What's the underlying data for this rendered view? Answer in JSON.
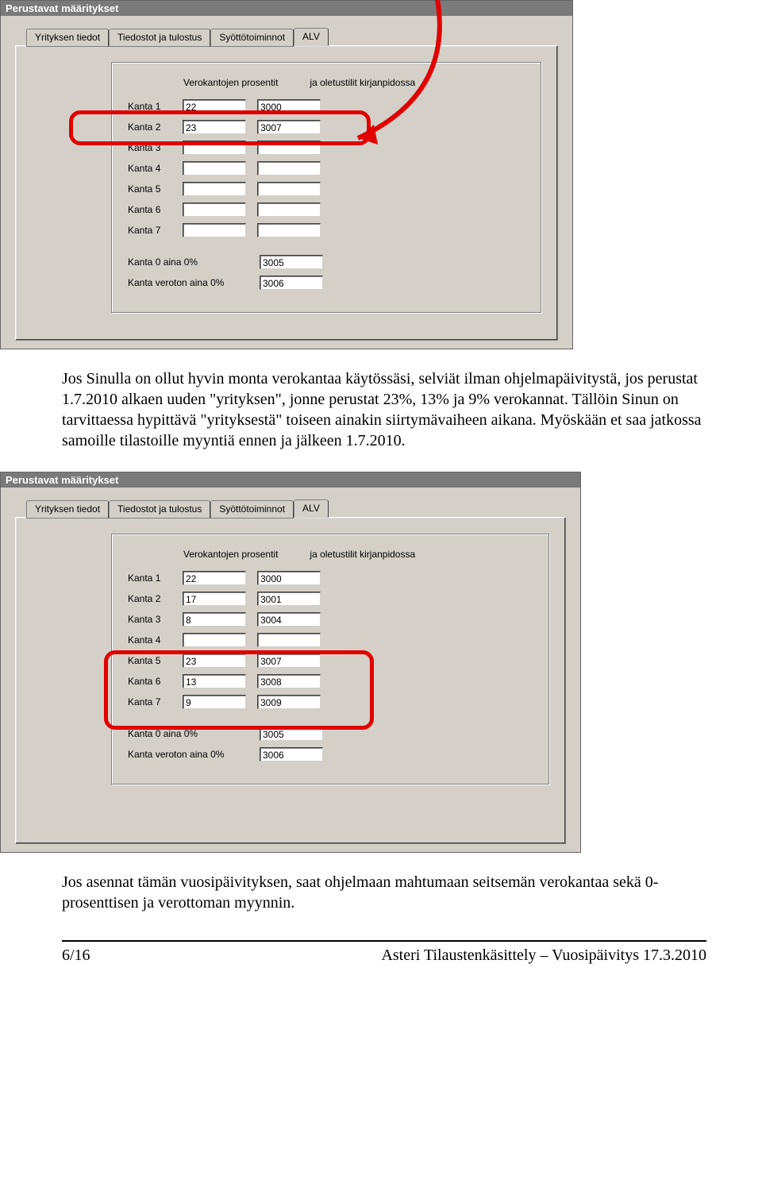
{
  "paragraph1": "Jos Sinulla on ollut hyvin monta verokantaa käytössäsi, selviät ilman ohjelmapäivitystä, jos perustat 1.7.2010 alkaen uuden \"yrityksen\", jonne perustat 23%, 13% ja 9% verokannat. Tällöin Sinun on tarvittaessa hypittävä \"yrityksestä\" toiseen ainakin siirtymävaiheen aikana. Myöskään et saa jatkossa samoille tilastoille myyntiä ennen ja jälkeen 1.7.2010.",
  "paragraph2": "Jos asennat tämän vuosipäivityksen, saat ohjelmaan mahtumaan seitsemän verokantaa sekä 0-prosenttisen ja verottoman myynnin.",
  "window": {
    "title": "Perustavat määritykset",
    "tabs": [
      "Yrityksen tiedot",
      "Tiedostot ja tulostus",
      "Syöttötoiminnot",
      "ALV"
    ],
    "col1": "Verokantojen prosentit",
    "col2": "ja oletustilit kirjanpidossa",
    "rowlabels": [
      "Kanta 1",
      "Kanta 2",
      "Kanta 3",
      "Kanta 4",
      "Kanta 5",
      "Kanta 6",
      "Kanta 7"
    ],
    "extra_labels": [
      "Kanta 0 aina 0%",
      "Kanta veroton aina 0%"
    ]
  },
  "screenshot1": {
    "rates": [
      "22",
      "23",
      "",
      "",
      "",
      "",
      ""
    ],
    "accts": [
      "3000",
      "3007",
      "",
      "",
      "",
      "",
      ""
    ],
    "extra_accts": [
      "3005",
      "3006"
    ]
  },
  "screenshot2": {
    "rates": [
      "22",
      "17",
      "8",
      "",
      "23",
      "13",
      "9"
    ],
    "accts": [
      "3000",
      "3001",
      "3004",
      "",
      "3007",
      "3008",
      "3009"
    ],
    "extra_accts": [
      "3005",
      "3006"
    ]
  },
  "footer": {
    "left": "6/16",
    "right": "Asteri Tilaustenkäsittely – Vuosipäivitys 17.3.2010"
  }
}
